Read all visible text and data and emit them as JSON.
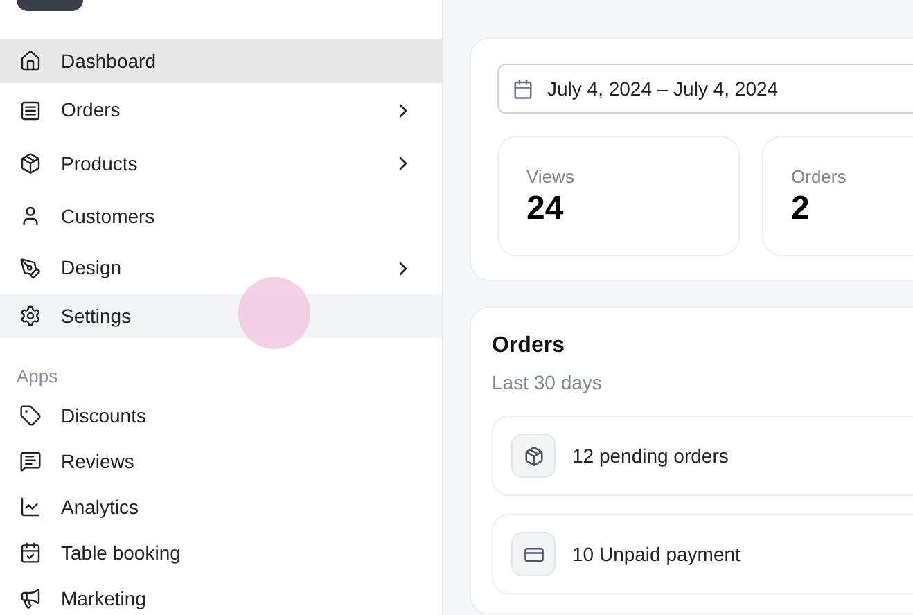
{
  "sidebar": {
    "nav_items": [
      {
        "label": "Dashboard",
        "selected": true,
        "hovered": false,
        "expandable": false
      },
      {
        "label": "Orders",
        "selected": false,
        "hovered": false,
        "expandable": true
      },
      {
        "label": "Products",
        "selected": false,
        "hovered": false,
        "expandable": true
      },
      {
        "label": "Customers",
        "selected": false,
        "hovered": false,
        "expandable": false
      },
      {
        "label": "Design",
        "selected": false,
        "hovered": false,
        "expandable": true
      },
      {
        "label": "Settings",
        "selected": false,
        "hovered": true,
        "expandable": false
      }
    ],
    "apps_heading": "Apps",
    "app_items": [
      {
        "label": "Discounts",
        "selected": false
      },
      {
        "label": "Reviews",
        "selected": false
      },
      {
        "label": "Analytics",
        "selected": false
      },
      {
        "label": "Table booking",
        "selected": false
      },
      {
        "label": "Marketing",
        "selected": false
      }
    ]
  },
  "overview": {
    "date_range": "July 4, 2024 – July 4, 2024",
    "stats": [
      {
        "label": "Views",
        "value": "24"
      },
      {
        "label": "Orders",
        "value": "2"
      }
    ]
  },
  "orders_card": {
    "title": "Orders",
    "subtitle": "Last 30 days",
    "items": [
      {
        "text": "12 pending orders"
      },
      {
        "text": "10 Unpaid payment"
      }
    ]
  }
}
